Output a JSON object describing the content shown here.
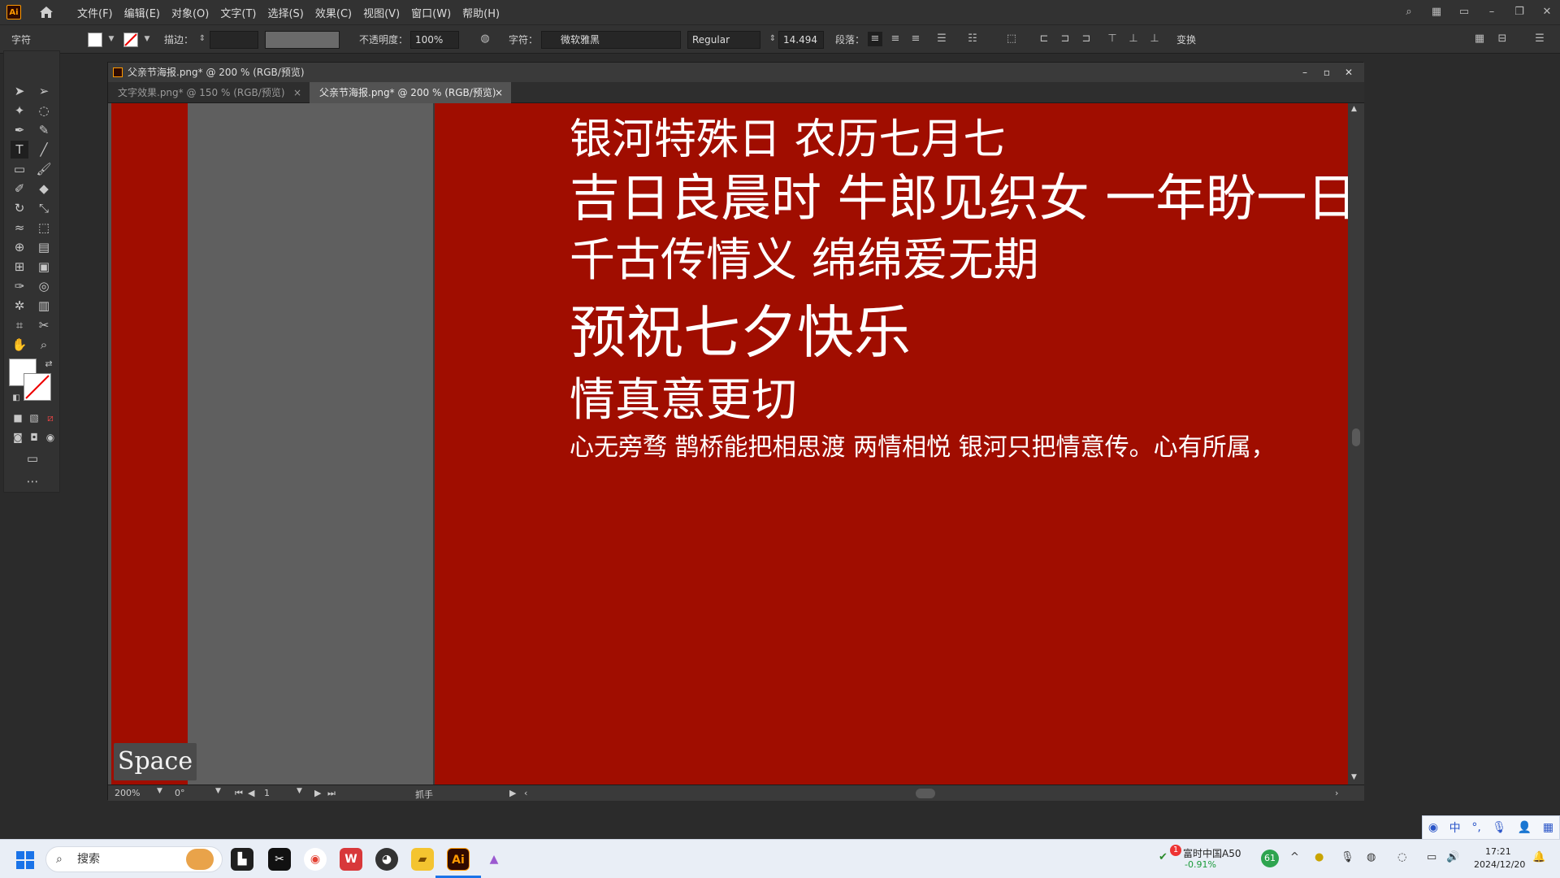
{
  "app": {
    "logo": "Ai",
    "menus": [
      "文件(F)",
      "编辑(E)",
      "对象(O)",
      "文字(T)",
      "选择(S)",
      "效果(C)",
      "视图(V)",
      "窗口(W)",
      "帮助(H)"
    ]
  },
  "control_bar": {
    "panel_label": "字符",
    "stroke_label": "描边：",
    "opacity_label": "不透明度：",
    "opacity_value": "100%",
    "char_label": "字符：",
    "font_name": "微软雅黑",
    "font_style": "Regular",
    "font_size": "14.494",
    "paragraph_label": "段落：",
    "transform_label": "变换"
  },
  "document": {
    "title": "父亲节海报.png* @ 200 % (RGB/预览)",
    "tabs": [
      {
        "label": "文字效果.png* @ 150 % (RGB/预览)",
        "active": false
      },
      {
        "label": "父亲节海报.png* @ 200 % (RGB/预览)",
        "active": true
      }
    ],
    "artboard_text": [
      "银河特殊日  农历七月七",
      "吉日良晨时  牛郎见织女  一年盼一日",
      "千古传情义 绵绵爱无期",
      "预祝七夕快乐",
      "情真意更切",
      "心无旁骛  鹊桥能把相思渡  两情相悦  银河只把情意传。心有所属，"
    ],
    "status": {
      "zoom": "200%",
      "rotation": "0°",
      "page": "1",
      "tool_name": "抓手"
    }
  },
  "overlay": {
    "key_hint": "Space"
  },
  "taskbar": {
    "search_placeholder": "搜索",
    "stock_name": "富时中国A50",
    "stock_change": "-0.91%",
    "stock_badge": "1",
    "weather_badge": "61",
    "time": "17:21",
    "date": "2024/12/20",
    "ime_mode": "中"
  },
  "colors": {
    "artboard_red": "#a00d00",
    "ui_dark": "#323232",
    "canvas_gray": "#535353"
  }
}
